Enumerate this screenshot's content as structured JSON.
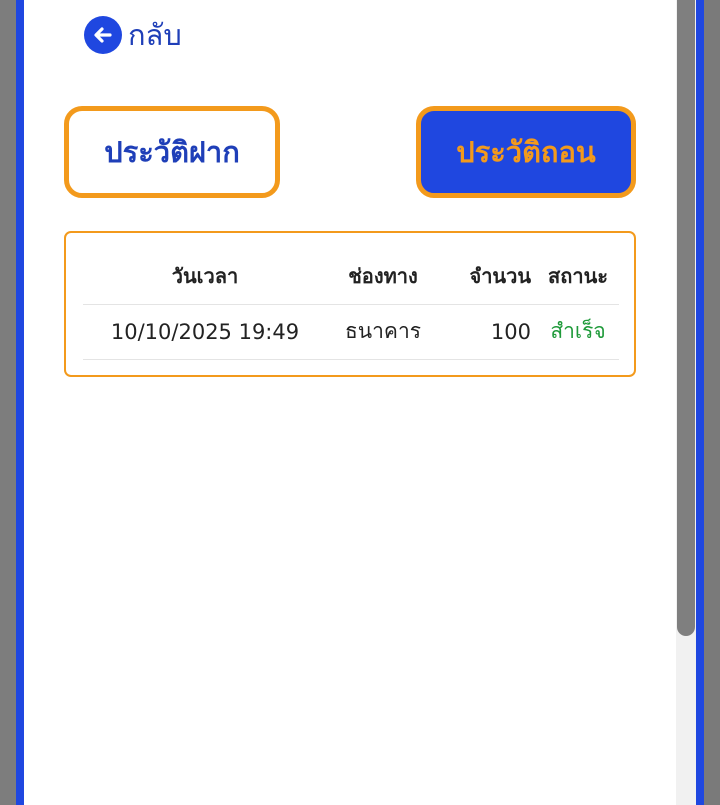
{
  "nav": {
    "back_label": "กลับ"
  },
  "tabs": {
    "deposit_label": "ประวัติฝาก",
    "withdraw_label": "ประวัติถอน"
  },
  "table": {
    "headers": [
      "วันเวลา",
      "ช่องทาง",
      "จำนวน",
      "สถานะ"
    ],
    "rows": [
      {
        "datetime": "10/10/2025 19:49",
        "channel": "ธนาคาร",
        "amount": "100",
        "status": "สำเร็จ"
      }
    ]
  },
  "colors": {
    "accent_blue": "#1f47e0",
    "accent_orange": "#f39a1c",
    "status_success": "#1f9a3a"
  }
}
